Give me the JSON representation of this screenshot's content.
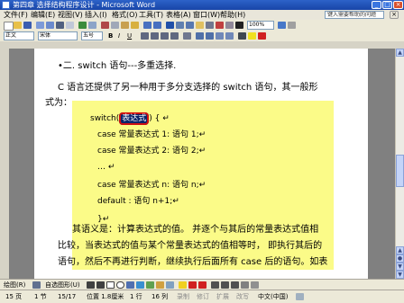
{
  "window": {
    "title": "第四章 选择结构程序设计 - Microsoft Word",
    "help_placeholder": "键入需要帮助的问题"
  },
  "menu": [
    "文件(F)",
    "编辑(E)",
    "视图(V)",
    "插入(I)",
    "格式(O)",
    "工具(T)",
    "表格(A)",
    "窗口(W)",
    "帮助(H)"
  ],
  "toolbar": {
    "zoom": "100%",
    "style": "正文",
    "font": "宋体",
    "size": "五号",
    "accent": "#fbfb88"
  },
  "document": {
    "heading": "•二.  switch 语句---多重选择.",
    "intro_1": "C 语言还提供了另一种用于多分支选择的 switch 语句，其一般形",
    "intro_2": "式为：",
    "code_prefix": "switch(",
    "code_selected": "表达式",
    "code_suffix": ") {  ↵",
    "code_lines": [
      "case 常量表达式 1:    语句 1;↵",
      "case 常量表达式 2:    语句 2;↵",
      "…  ↵",
      "case 常量表达式 n:    语句 n;↵",
      "default          :    语句 n+1;↵",
      "}↵"
    ],
    "para_1": "其语义是：计算表达式的值。  并逐个与其后的常量表达式值相",
    "para_2": "比较，当表达式的值与某个常量表达式的值相等时，  即执行其后的",
    "para_3": "语句，然后不再进行判断，继续执行后面所有 case 后的语句。如表"
  },
  "drawing": {
    "draw_label": "绘图(R)",
    "autoshapes_label": "自选图形(U)"
  },
  "status": {
    "page": "15 页",
    "section": "1 节",
    "pages": "15/17",
    "position": "位置 1.8厘米",
    "line": "1 行",
    "col": "16 列",
    "rec": "录制",
    "trk": "修订",
    "ext": "扩展",
    "ovr": "改写",
    "lang": "中文(中国)"
  }
}
